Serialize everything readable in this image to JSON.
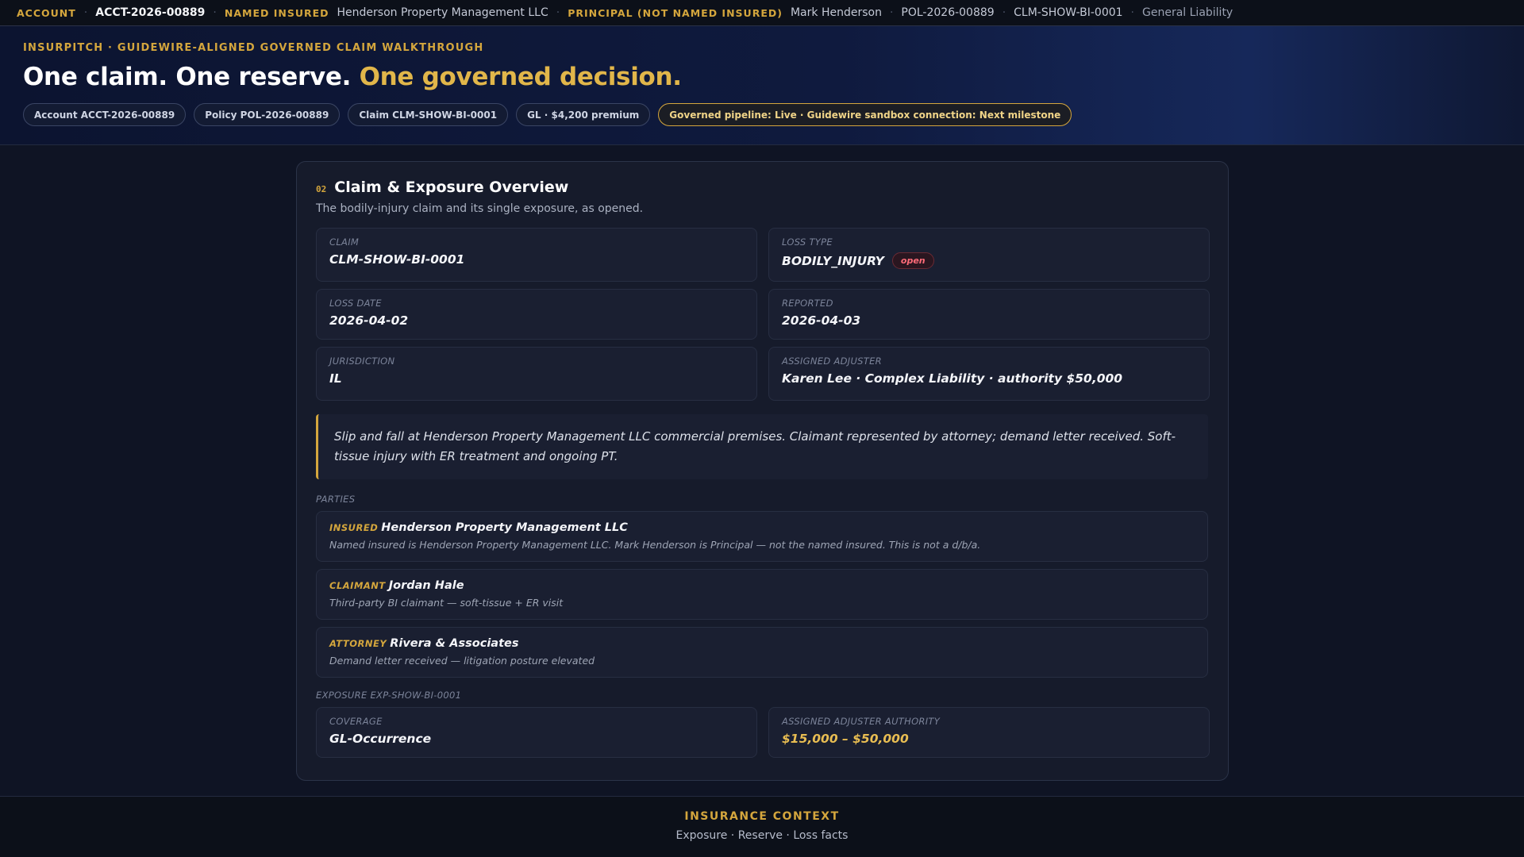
{
  "topbar": {
    "account_label": "ACCOUNT",
    "account_value": "ACCT-2026-00889",
    "named_insured_label": "NAMED INSURED",
    "named_insured_value": "Henderson Property Management LLC",
    "principal_label": "PRINCIPAL (NOT NAMED INSURED)",
    "principal_value": "Mark Henderson",
    "policy": "POL-2026-00889",
    "claim": "CLM-SHOW-BI-0001",
    "line": "General Liability"
  },
  "hero": {
    "eyebrow": "INSURPITCH · GUIDEWIRE-ALIGNED GOVERNED CLAIM WALKTHROUGH",
    "title_main": "One claim. One reserve.",
    "title_accent": "One governed decision.",
    "chips": [
      "Account ACCT-2026-00889",
      "Policy POL-2026-00889",
      "Claim CLM-SHOW-BI-0001",
      "GL · $4,200 premium",
      "Governed pipeline: Live · Guidewire sandbox connection: Next milestone"
    ]
  },
  "section": {
    "number": "02",
    "title": "Claim & Exposure Overview",
    "subtitle": "The bodily-injury claim and its single exposure, as opened."
  },
  "fields": {
    "claim_label": "CLAIM",
    "claim_value": "CLM-SHOW-BI-0001",
    "loss_type_label": "LOSS TYPE",
    "loss_type_value": "BODILY_INJURY",
    "status_badge": "open",
    "loss_date_label": "LOSS DATE",
    "loss_date_value": "2026-04-02",
    "reported_label": "REPORTED",
    "reported_value": "2026-04-03",
    "jurisdiction_label": "JURISDICTION",
    "jurisdiction_value": "IL",
    "adjuster_label": "ASSIGNED ADJUSTER",
    "adjuster_value": "Karen Lee · Complex Liability · authority $50,000"
  },
  "summary": "Slip and fall at Henderson Property Management LLC commercial premises. Claimant represented by attorney; demand letter received. Soft-tissue injury with ER treatment and ongoing PT.",
  "parties": {
    "label": "PARTIES",
    "items": [
      {
        "role": "INSURED",
        "name": "Henderson Property Management LLC",
        "desc": "Named insured is Henderson Property Management LLC. Mark Henderson is Principal — not the named insured. This is not a d/b/a."
      },
      {
        "role": "CLAIMANT",
        "name": "Jordan Hale",
        "desc": "Third-party BI claimant — soft-tissue + ER visit"
      },
      {
        "role": "ATTORNEY",
        "name": "Rivera & Associates",
        "desc": "Demand letter received — litigation posture elevated"
      }
    ]
  },
  "exposure": {
    "label": "EXPOSURE EXP-SHOW-BI-0001",
    "coverage_label": "COVERAGE",
    "coverage_value": "GL-Occurrence",
    "authority_label": "ASSIGNED ADJUSTER AUTHORITY",
    "authority_value": "$15,000 – $50,000"
  },
  "footer": {
    "title": "INSURANCE CONTEXT",
    "subtitle": "Exposure · Reserve · Loss facts"
  },
  "colors": {
    "accent_gold": "#d4a63d",
    "background": "#0f1424",
    "card": "#161b2b",
    "status_open": "#ff6b78"
  }
}
